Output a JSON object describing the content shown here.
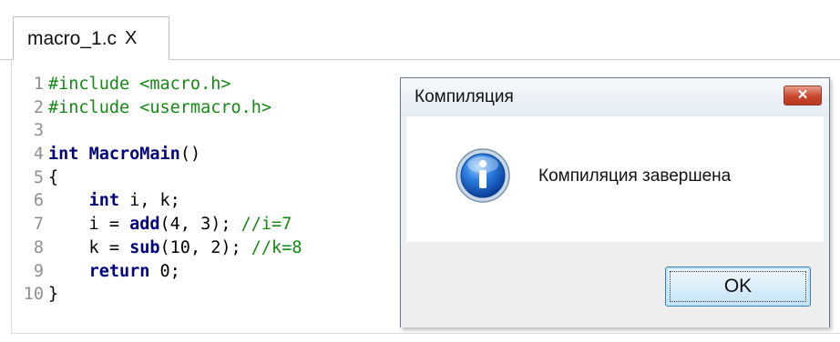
{
  "tab": {
    "title": "macro_1.c",
    "close": "X"
  },
  "code": {
    "line_numbers": [
      "1",
      "2",
      "3",
      "4",
      "5",
      "6",
      "7",
      "8",
      "9",
      "10"
    ],
    "lines": [
      {
        "parts": [
          {
            "t": "#include <macro.h>",
            "c": "pp"
          }
        ]
      },
      {
        "parts": [
          {
            "t": "#include <usermacro.h>",
            "c": "pp"
          }
        ]
      },
      {
        "parts": [
          {
            "t": "",
            "c": "plain"
          }
        ]
      },
      {
        "parts": [
          {
            "t": "int",
            "c": "kw"
          },
          {
            "t": " ",
            "c": "plain"
          },
          {
            "t": "MacroMain",
            "c": "fn"
          },
          {
            "t": "()",
            "c": "plain"
          }
        ]
      },
      {
        "parts": [
          {
            "t": "{",
            "c": "plain"
          }
        ]
      },
      {
        "parts": [
          {
            "t": "    ",
            "c": "plain"
          },
          {
            "t": "int",
            "c": "kw"
          },
          {
            "t": " i, k;",
            "c": "plain"
          }
        ]
      },
      {
        "parts": [
          {
            "t": "    i = ",
            "c": "plain"
          },
          {
            "t": "add",
            "c": "fn"
          },
          {
            "t": "(4, 3); ",
            "c": "plain"
          },
          {
            "t": "//i=7",
            "c": "cm"
          }
        ]
      },
      {
        "parts": [
          {
            "t": "    k = ",
            "c": "plain"
          },
          {
            "t": "sub",
            "c": "fn"
          },
          {
            "t": "(10, 2); ",
            "c": "plain"
          },
          {
            "t": "//k=8",
            "c": "cm"
          }
        ]
      },
      {
        "parts": [
          {
            "t": "    ",
            "c": "plain"
          },
          {
            "t": "return",
            "c": "kw"
          },
          {
            "t": " 0;",
            "c": "plain"
          }
        ]
      },
      {
        "parts": [
          {
            "t": "}",
            "c": "plain"
          }
        ]
      }
    ]
  },
  "dialog": {
    "title": "Компиляция",
    "close_label": "✕",
    "icon": "info-icon",
    "message": "Компиляция завершена",
    "ok_label": "OK"
  }
}
